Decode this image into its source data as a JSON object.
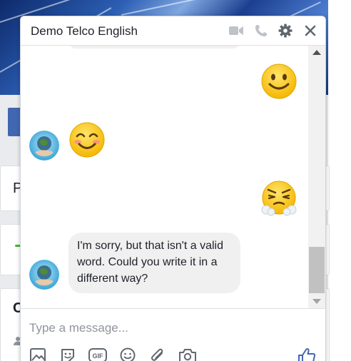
{
  "background_page": {
    "card_letter_p": "P",
    "card_letter_c": "C"
  },
  "chat": {
    "title": "Demo Telco English",
    "header_icons": [
      "video-camera-icon",
      "phone-icon",
      "gear-icon",
      "close-icon"
    ],
    "messages": [
      {
        "sender": "user",
        "type": "emoji",
        "emoji": "🙂"
      },
      {
        "sender": "bot",
        "type": "emoji",
        "emoji": "😊"
      },
      {
        "sender": "user",
        "type": "emoji",
        "emoji": "😤"
      },
      {
        "sender": "bot",
        "type": "text",
        "text": "I'm sorry, but that isn't a valid word. Could you write it in a different way?"
      }
    ],
    "composer": {
      "placeholder": "Type a message...",
      "value": "",
      "toolbar_icons": [
        "photo-icon",
        "sticker-icon",
        "gif-icon",
        "emoji-icon",
        "attachment-icon",
        "camera-icon",
        "thumbs-up-icon"
      ],
      "gif_label": "GIF"
    }
  },
  "colors": {
    "accent": "#4267b2",
    "bubble_bg": "#f1f0f0",
    "header_icon": "#bec2c9",
    "icon_dark": "#606770"
  }
}
